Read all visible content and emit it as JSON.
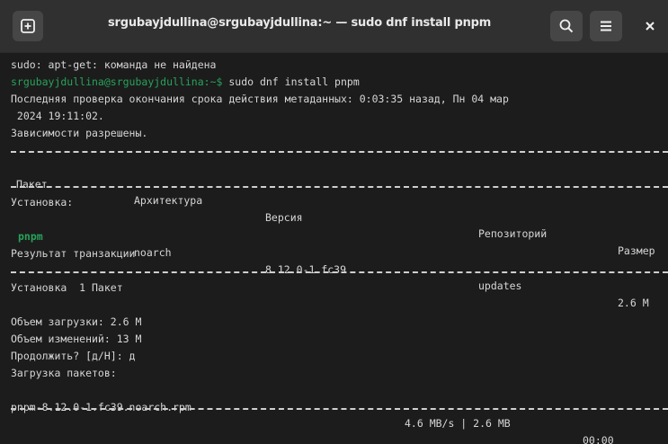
{
  "window": {
    "title": "srgubayjdullina@srgubayjdullina:~ — sudo dnf install pnpm",
    "new_tab_icon": "new-tab-icon",
    "search_icon": "search-icon",
    "menu_icon": "hamburger-menu-icon",
    "close_icon": "close-icon",
    "close_glyph": "×"
  },
  "terminal": {
    "line1": "sudo: apt-get: команда не найдена",
    "prompt_user": "srgubayjdullina@srgubayjdullina",
    "prompt_suffix": ":~$",
    "prompt_cmd": " sudo dnf install pnpm",
    "line3": "Последняя проверка окончания срока действия метаданных: 0:03:35 назад, Пн 04 мар",
    "line4": " 2024 19:11:02.",
    "line5": "Зависимости разрешены.",
    "headers": {
      "package": "Пакет",
      "arch": "Архитектура",
      "version": "Версия",
      "repo": "Репозиторий",
      "size": "Размер"
    },
    "install_label": "Установка:",
    "row": {
      "package": "pnpm",
      "arch": "noarch",
      "version": "8.12.0-1.fc39",
      "repo": "updates",
      "size": "2.6 M"
    },
    "summary_title": "Результат транзакции",
    "summary_install": "Установка  1 Пакет",
    "download_size": "Объем загрузки: 2.6 M",
    "installed_size": "Объем изменений: 13 M",
    "confirm": "Продолжить? [д/Н]: д",
    "downloading": "Загрузка пакетов:",
    "download_file": "pnpm-8.12.0-1.fc39.noarch.rpm",
    "download_speed": "4.6 MB/s | 2.6 MB",
    "download_time": "00:00"
  },
  "colors": {
    "background": "#1c1c1c",
    "titlebar": "#303030",
    "text": "#d6d6d6",
    "prompt_green": "#27a35a"
  }
}
